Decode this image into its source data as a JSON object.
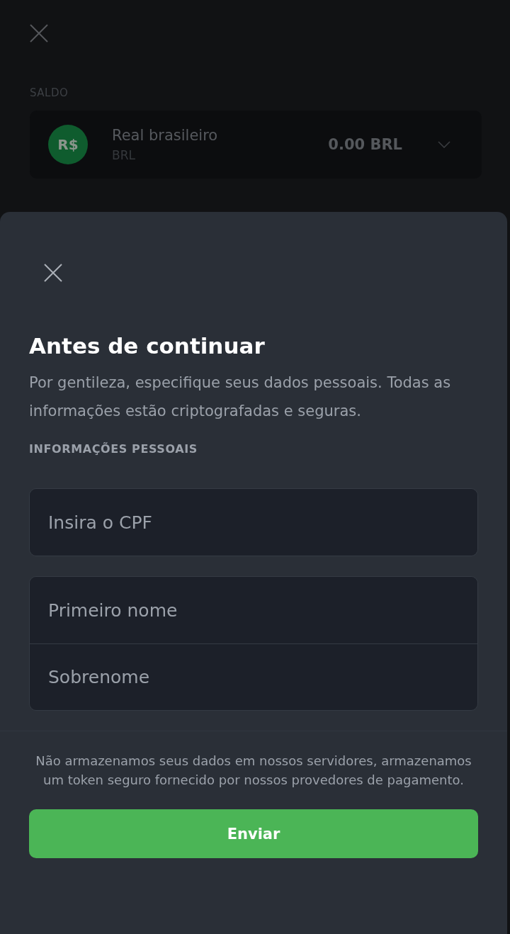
{
  "background": {
    "balance_label": "SALDO",
    "balance": {
      "currency_symbol": "R$",
      "name": "Real brasileiro",
      "code": "BRL",
      "amount": "0.00 BRL"
    }
  },
  "sheet": {
    "title": "Antes de continuar",
    "description": "Por gentileza, especifique seus dados pessoais. Todas as informações estão criptografadas e seguras.",
    "section_label": "INFORMAÇÕES PESSOAIS",
    "field_groups": [
      {
        "fields": [
          {
            "placeholder": "Insira o CPF"
          }
        ]
      },
      {
        "fields": [
          {
            "placeholder": "Primeiro nome"
          },
          {
            "placeholder": "Sobrenome"
          }
        ]
      }
    ],
    "note": "Não armazenamos seus dados em nossos servidores, armazenamos um token seguro fornecido por nossos provedores de pagamento.",
    "submit_button": "Enviar"
  }
}
